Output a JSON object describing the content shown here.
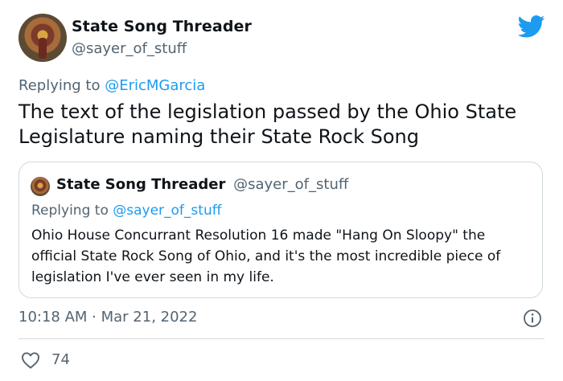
{
  "author": {
    "display_name": "State Song Threader",
    "handle": "@sayer_of_stuff"
  },
  "reply_to": {
    "prefix": "Replying to",
    "mention": "@EricMGarcia"
  },
  "tweet_text": "The text of the legislation passed by the Ohio State Legislature naming their State Rock Song",
  "quoted_tweet": {
    "display_name": "State Song Threader",
    "handle": "@sayer_of_stuff",
    "reply_prefix": "Replying to",
    "reply_mention": "@sayer_of_stuff",
    "text": "Ohio House Concurrant Resolution 16 made \"Hang On Sloopy\" the official State Rock Song of Ohio, and it's the most incredible piece of legislation I've ever seen in my life."
  },
  "timestamp": "10:18 AM · Mar 21, 2022",
  "likes": "74",
  "icons": {
    "brand": "twitter-bird-icon",
    "info": "info-icon",
    "like": "heart-icon"
  },
  "colors": {
    "accent": "#1d9bf0",
    "secondary_text": "#536471",
    "border": "#cfd9de"
  }
}
